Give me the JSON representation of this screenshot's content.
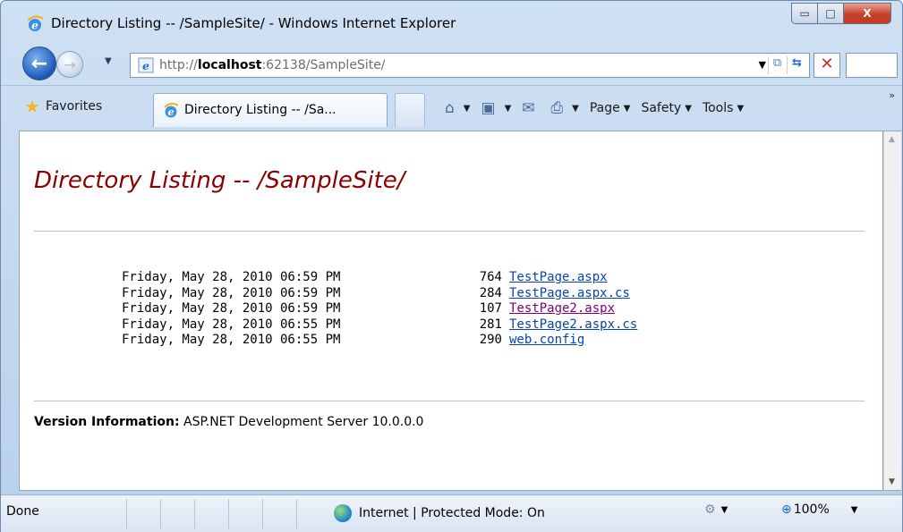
{
  "window": {
    "title": "Directory Listing -- /SampleSite/ - Windows Internet Explorer",
    "minimize_glyph": "▭",
    "maximize_glyph": "□",
    "close_glyph": "X"
  },
  "addressbar": {
    "url_prefix": "http://",
    "url_host": "localhost",
    "url_rest": ":62138/SampleSite/"
  },
  "favorites": {
    "label": "Favorites"
  },
  "tab": {
    "label": "Directory Listing -- /Sa..."
  },
  "commandbar": {
    "page_label": "Page",
    "safety_label": "Safety",
    "tools_label": "Tools"
  },
  "page": {
    "title": "Directory Listing -- /SampleSite/",
    "files": [
      {
        "date": "Friday, May 28, 2010 06:59 PM",
        "size": "764",
        "name": "TestPage.aspx",
        "visited": false
      },
      {
        "date": "Friday, May 28, 2010 06:59 PM",
        "size": "284",
        "name": "TestPage.aspx.cs",
        "visited": false
      },
      {
        "date": "Friday, May 28, 2010 06:59 PM",
        "size": "107",
        "name": "TestPage2.aspx",
        "visited": true
      },
      {
        "date": "Friday, May 28, 2010 06:55 PM",
        "size": "281",
        "name": "TestPage2.aspx.cs",
        "visited": false
      },
      {
        "date": "Friday, May 28, 2010 06:55 PM",
        "size": "290",
        "name": "web.config",
        "visited": false
      }
    ],
    "version_label": "Version Information:",
    "version_value": "ASP.NET Development Server 10.0.0.0"
  },
  "statusbar": {
    "status": "Done",
    "zone": "Internet | Protected Mode: On",
    "zoom": "100%"
  },
  "colors": {
    "title_text": "#8b0000",
    "link": "#0645ad",
    "visited_link": "#800080"
  },
  "icons": [
    "ie-logo-icon",
    "back-arrow-icon",
    "forward-arrow-icon",
    "star-icon",
    "home-icon",
    "feeds-icon",
    "mail-icon",
    "print-icon",
    "globe-icon",
    "zoom-icon"
  ]
}
